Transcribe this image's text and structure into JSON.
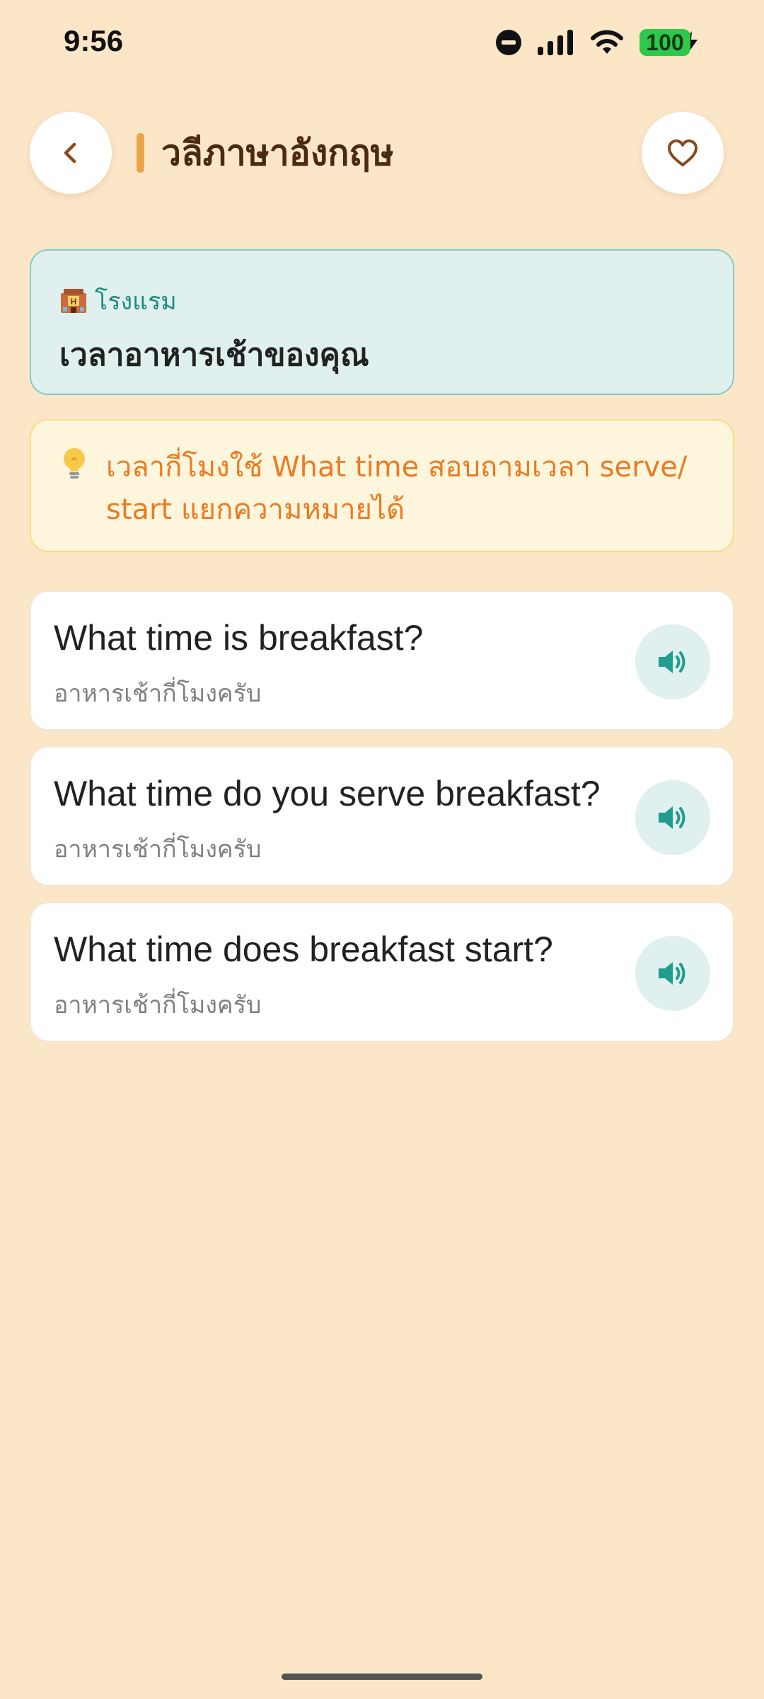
{
  "status_bar": {
    "time": "9:56",
    "battery": "100",
    "icons": [
      "do-not-disturb-icon",
      "cellular-signal-icon",
      "wifi-icon",
      "battery-icon",
      "charging-bolt-icon"
    ],
    "battery_color": "#2fc84a"
  },
  "header": {
    "title": "วลีภาษาอังกฤษ",
    "back_icon": "chevron-left-icon",
    "favorite_icon": "heart-outline-icon",
    "accent_color": "#e9a547"
  },
  "category": {
    "icon": "hotel-icon",
    "label": "โรงแรม",
    "title": "เวลาอาหารเช้าของคุณ"
  },
  "tip": {
    "icon": "lightbulb-icon",
    "text": "เวลากี่โมงใช้ What time สอบถามเวลา serve/ start แยกความหมายได้"
  },
  "phrases": [
    {
      "english": "What time is breakfast?",
      "thai": "อาหารเช้ากี่โมงครับ"
    },
    {
      "english": "What time do you serve breakfast?",
      "thai": "อาหารเช้ากี่โมงครับ"
    },
    {
      "english": "What time does breakfast start?",
      "thai": "อาหารเช้ากี่โมงครับ"
    }
  ],
  "colors": {
    "background": "#fbe6c8",
    "teal": "#1f8a7d",
    "tip_orange": "#ec7a22"
  }
}
